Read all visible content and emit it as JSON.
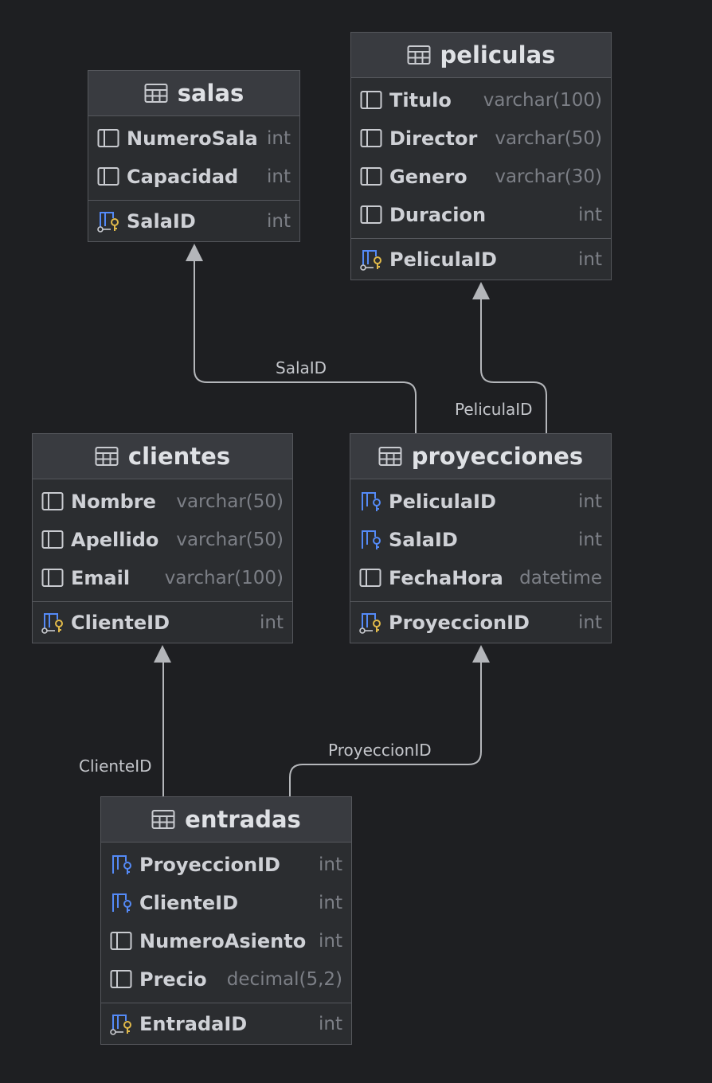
{
  "tables": {
    "salas": {
      "name": "salas",
      "columns": [
        {
          "name": "NumeroSala",
          "type": "int",
          "kind": "column"
        },
        {
          "name": "Capacidad",
          "type": "int",
          "kind": "column"
        }
      ],
      "pk": {
        "name": "SalaID",
        "type": "int",
        "kind": "pk"
      }
    },
    "peliculas": {
      "name": "peliculas",
      "columns": [
        {
          "name": "Titulo",
          "type": "varchar(100)",
          "kind": "column"
        },
        {
          "name": "Director",
          "type": "varchar(50)",
          "kind": "column"
        },
        {
          "name": "Genero",
          "type": "varchar(30)",
          "kind": "column"
        },
        {
          "name": "Duracion",
          "type": "int",
          "kind": "column"
        }
      ],
      "pk": {
        "name": "PeliculaID",
        "type": "int",
        "kind": "pk"
      }
    },
    "clientes": {
      "name": "clientes",
      "columns": [
        {
          "name": "Nombre",
          "type": "varchar(50)",
          "kind": "column"
        },
        {
          "name": "Apellido",
          "type": "varchar(50)",
          "kind": "column"
        },
        {
          "name": "Email",
          "type": "varchar(100)",
          "kind": "column"
        }
      ],
      "pk": {
        "name": "ClienteID",
        "type": "int",
        "kind": "pk"
      }
    },
    "proyecciones": {
      "name": "proyecciones",
      "columns": [
        {
          "name": "PeliculaID",
          "type": "int",
          "kind": "fk"
        },
        {
          "name": "SalaID",
          "type": "int",
          "kind": "fk"
        },
        {
          "name": "FechaHora",
          "type": "datetime",
          "kind": "column"
        }
      ],
      "pk": {
        "name": "ProyeccionID",
        "type": "int",
        "kind": "pk"
      }
    },
    "entradas": {
      "name": "entradas",
      "columns": [
        {
          "name": "ProyeccionID",
          "type": "int",
          "kind": "fk"
        },
        {
          "name": "ClienteID",
          "type": "int",
          "kind": "fk"
        },
        {
          "name": "NumeroAsiento",
          "type": "int",
          "kind": "column"
        },
        {
          "name": "Precio",
          "type": "decimal(5,2)",
          "kind": "column"
        }
      ],
      "pk": {
        "name": "EntradaID",
        "type": "int",
        "kind": "pk"
      }
    }
  },
  "relations": [
    {
      "from": "proyecciones",
      "to": "salas",
      "label": "SalaID"
    },
    {
      "from": "proyecciones",
      "to": "peliculas",
      "label": "PeliculaID"
    },
    {
      "from": "entradas",
      "to": "clientes",
      "label": "ClienteID"
    },
    {
      "from": "entradas",
      "to": "proyecciones",
      "label": "ProyeccionID"
    }
  ],
  "colors": {
    "background": "#1e1f22",
    "table_body": "#2b2d30",
    "table_header": "#393b40",
    "border": "#55575c",
    "fk_key": "#548af7",
    "pk_key": "#e0b94a",
    "connector": "#b4b6ba"
  }
}
